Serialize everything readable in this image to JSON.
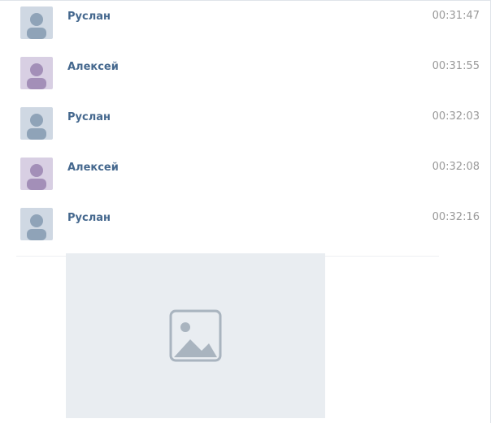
{
  "messages": [
    {
      "sender": "Руслан",
      "time": "00:31:47",
      "avatar_icon": "user-avatar-ruslan"
    },
    {
      "sender": "Алексей",
      "time": "00:31:55",
      "avatar_icon": "user-avatar-aleksey"
    },
    {
      "sender": "Руслан",
      "time": "00:32:03",
      "avatar_icon": "user-avatar-ruslan"
    },
    {
      "sender": "Алексей",
      "time": "00:32:08",
      "avatar_icon": "user-avatar-aleksey"
    },
    {
      "sender": "Руслан",
      "time": "00:32:16",
      "avatar_icon": "user-avatar-ruslan"
    }
  ],
  "attachment": {
    "icon": "photo-attachment"
  },
  "colors": {
    "sender_name": "#45688e",
    "timestamp": "#999999",
    "text": "#000000"
  }
}
